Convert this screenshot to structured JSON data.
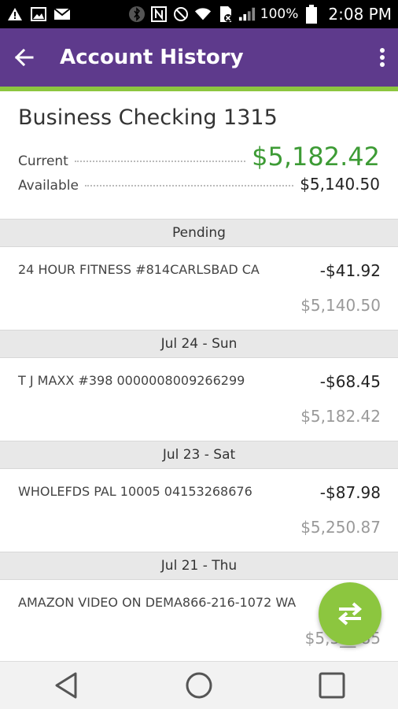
{
  "status_bar": {
    "battery_percent": "100%",
    "time": "2:08 PM",
    "left_icons": [
      "warning-icon",
      "image-icon",
      "mail-icon"
    ],
    "right_icons": [
      "bluetooth-icon",
      "nfc-icon",
      "do-not-disturb-icon",
      "wifi-icon",
      "sim-icon",
      "signal-icon",
      "battery-icon"
    ]
  },
  "app_bar": {
    "title": "Account History",
    "accent_color": "#5e3a8c",
    "underline_color": "#8cc63f"
  },
  "account": {
    "name": "Business Checking 1315",
    "current_label": "Current",
    "current_value": "$5,182.42",
    "available_label": "Available",
    "available_value": "$5,140.50"
  },
  "sections": [
    {
      "header": "Pending",
      "transactions": [
        {
          "description": "24 HOUR FITNESS #814CARLSBAD CA",
          "amount": "-$41.92",
          "balance": "$5,140.50"
        }
      ]
    },
    {
      "header": "Jul 24 - Sun",
      "transactions": [
        {
          "description": "T J MAXX #398 0000008009266299",
          "amount": "-$68.45",
          "balance": "$5,182.42"
        }
      ]
    },
    {
      "header": "Jul 23 - Sat",
      "transactions": [
        {
          "description": "WHOLEFDS PAL 10005 04153268676",
          "amount": "-$87.98",
          "balance": "$5,250.87"
        }
      ]
    },
    {
      "header": "Jul 21 - Thu",
      "transactions": [
        {
          "description": "AMAZON VIDEO ON DEMA866-216-1072 WA",
          "amount": "",
          "balance": "$5,3__.85"
        }
      ]
    }
  ],
  "fab": {
    "icon": "transfer-icon"
  },
  "nav_bar": {
    "icons": [
      "back-nav-icon",
      "home-nav-icon",
      "recents-nav-icon"
    ]
  }
}
